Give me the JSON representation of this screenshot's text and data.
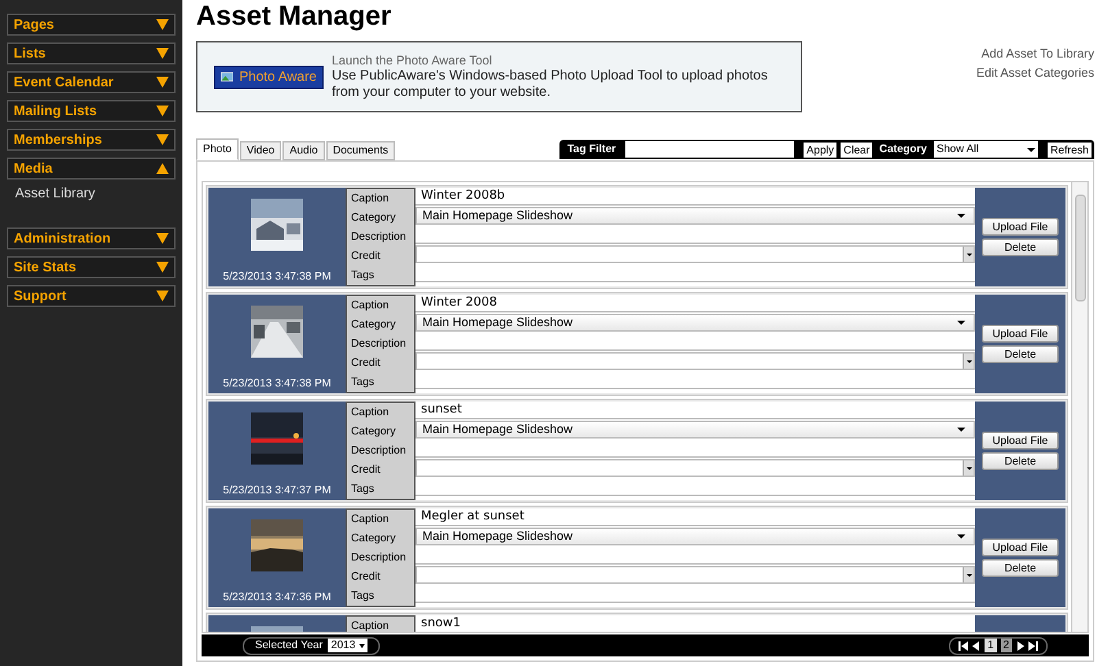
{
  "sidebar": {
    "items": [
      {
        "label": "Pages",
        "expanded": false
      },
      {
        "label": "Lists",
        "expanded": false
      },
      {
        "label": "Event Calendar",
        "expanded": false
      },
      {
        "label": "Mailing Lists",
        "expanded": false
      },
      {
        "label": "Memberships",
        "expanded": false
      },
      {
        "label": "Media",
        "expanded": true,
        "children": [
          {
            "label": "Asset Library"
          }
        ]
      },
      {
        "label": "Administration",
        "expanded": false
      },
      {
        "label": "Site Stats",
        "expanded": false
      },
      {
        "label": "Support",
        "expanded": false
      }
    ]
  },
  "page_title": "Asset Manager",
  "promo": {
    "button": "Photo Aware",
    "heading": "Launch the Photo Aware Tool",
    "text": "Use PublicAware's Windows-based Photo Upload Tool to upload photos from your computer to your website."
  },
  "links": [
    "Add Asset To Library",
    "Edit Asset Categories"
  ],
  "tabs": [
    {
      "label": "Photo",
      "selected": true
    },
    {
      "label": "Video",
      "selected": false
    },
    {
      "label": "Audio",
      "selected": false
    },
    {
      "label": "Documents",
      "selected": false
    }
  ],
  "toolbar": {
    "tag_filter_label": "Tag Filter",
    "apply": "Apply",
    "clear": "Clear",
    "category_label": "Category",
    "category_value": "Show All",
    "refresh": "Refresh"
  },
  "assets": [
    {
      "date": "5/23/2013 3:47:38 PM",
      "fields": [
        {
          "label": "Caption",
          "kind": "text",
          "value": "Winter 2008b"
        },
        {
          "label": "Category",
          "kind": "select",
          "value": "Main Homepage Slideshow"
        },
        {
          "label": "Description",
          "kind": "text"
        },
        {
          "label": "Credit",
          "kind": "combo"
        },
        {
          "label": "Tags",
          "kind": "text"
        }
      ],
      "buttons": [
        "Upload File",
        "Delete"
      ]
    },
    {
      "date": "5/23/2013 3:47:38 PM",
      "fields": [
        {
          "label": "Caption",
          "kind": "text",
          "value": "Winter 2008"
        },
        {
          "label": "Category",
          "kind": "select",
          "value": "Main Homepage Slideshow"
        },
        {
          "label": "Description",
          "kind": "text"
        },
        {
          "label": "Credit",
          "kind": "combo"
        },
        {
          "label": "Tags",
          "kind": "text"
        }
      ],
      "buttons": [
        "Upload File",
        "Delete"
      ]
    },
    {
      "date": "5/23/2013 3:47:37 PM",
      "fields": [
        {
          "label": "Caption",
          "kind": "text",
          "value": "sunset"
        },
        {
          "label": "Category",
          "kind": "select",
          "value": "Main Homepage Slideshow"
        },
        {
          "label": "Description",
          "kind": "text"
        },
        {
          "label": "Credit",
          "kind": "combo"
        },
        {
          "label": "Tags",
          "kind": "text"
        }
      ],
      "buttons": [
        "Upload File",
        "Delete"
      ]
    },
    {
      "date": "5/23/2013 3:47:36 PM",
      "fields": [
        {
          "label": "Caption",
          "kind": "text",
          "value": "Megler at sunset"
        },
        {
          "label": "Category",
          "kind": "select",
          "value": "Main Homepage Slideshow"
        },
        {
          "label": "Description",
          "kind": "text"
        },
        {
          "label": "Credit",
          "kind": "combo"
        },
        {
          "label": "Tags",
          "kind": "text"
        }
      ],
      "buttons": [
        "Upload File",
        "Delete"
      ]
    },
    {
      "fields": [
        {
          "label": "Caption",
          "kind": "text",
          "value": "snow1"
        }
      ]
    }
  ],
  "footer": {
    "year_label": "Selected Year",
    "year": "2013",
    "pages": [
      {
        "label": "1",
        "selected": true
      },
      {
        "label": "2",
        "selected": false
      }
    ]
  }
}
